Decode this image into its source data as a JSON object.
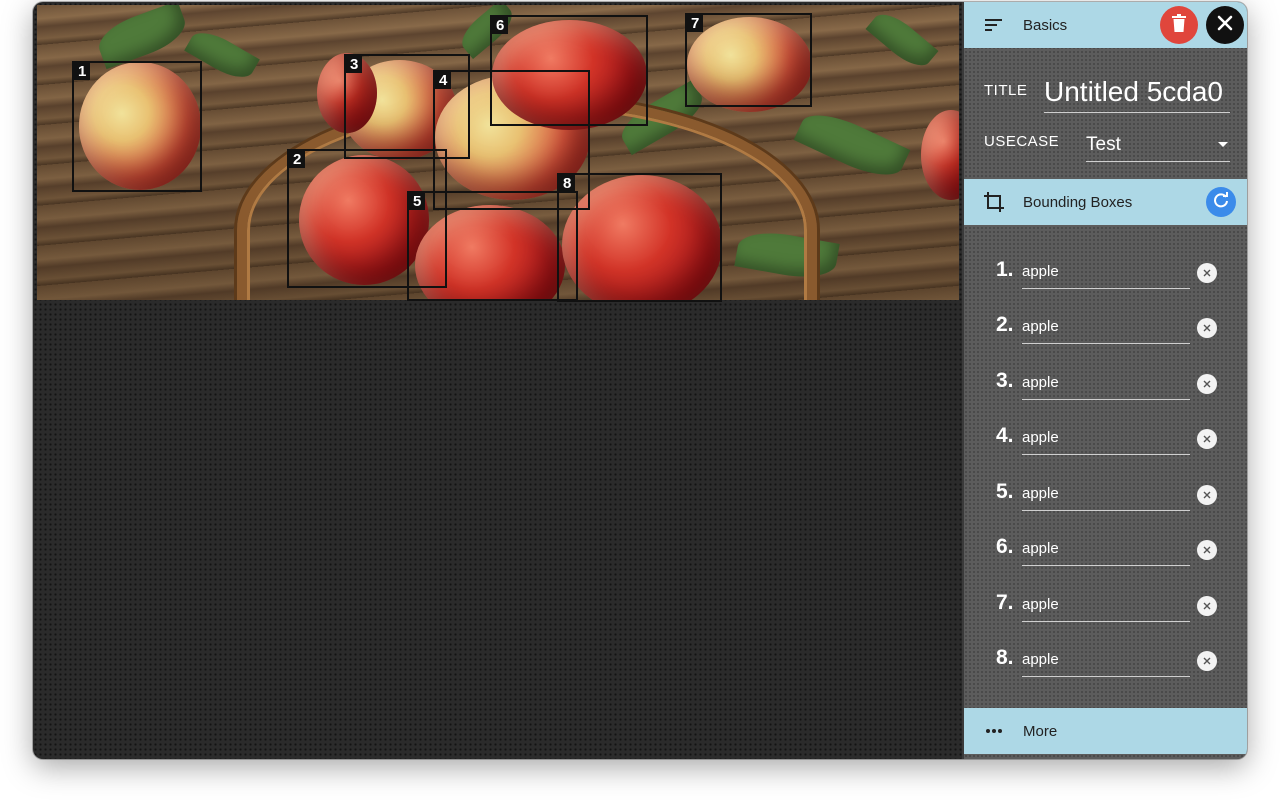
{
  "sidebar": {
    "basics_header": {
      "label": "Basics",
      "icon": "sort-lines-icon"
    },
    "title_field": {
      "label": "TITLE",
      "value": "Untitled 5cda0"
    },
    "usecase_field": {
      "label": "USECASE",
      "value": "Test"
    },
    "bbox_header": {
      "label": "Bounding Boxes",
      "icon": "crop-icon"
    },
    "bbox_items": [
      {
        "number": "1.",
        "label": "apple"
      },
      {
        "number": "2.",
        "label": "apple"
      },
      {
        "number": "3.",
        "label": "apple"
      },
      {
        "number": "4.",
        "label": "apple"
      },
      {
        "number": "5.",
        "label": "apple"
      },
      {
        "number": "6.",
        "label": "apple"
      },
      {
        "number": "7.",
        "label": "apple"
      },
      {
        "number": "8.",
        "label": "apple"
      }
    ],
    "more_header": {
      "label": "More",
      "icon": "more-horizontal-icon"
    }
  },
  "canvas": {
    "bbox_labels": [
      "1",
      "2",
      "3",
      "4",
      "5",
      "6",
      "7",
      "8"
    ]
  },
  "colors": {
    "header_bg": "#add8e6",
    "delete_button": "#e0463c",
    "close_button": "#111111",
    "refresh_button": "#3b8bea"
  }
}
